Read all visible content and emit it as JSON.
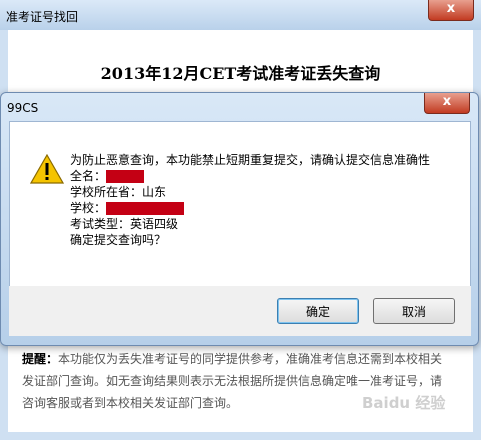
{
  "background_window": {
    "title": "准考证号找回",
    "close_label": "x",
    "heading": "2013年12月CET考试准考证丢失查询",
    "tip_label": "提醒：",
    "tip_text": "本功能仅为丢失准考证号的同学提供参考，准确准考信息还需到本校相关发证部门查询。如无查询结果则表示无法根据所提供信息确定唯一准考证号，请咨询客服或者到本校相关发证部门查询。"
  },
  "dialog": {
    "title": "99CS",
    "close_label": "x",
    "icon": "warning-icon",
    "message": {
      "line1": "为防止恶意查询，本功能禁止短期重复提交，请确认提交信息准确性",
      "name_label": "全名：",
      "province_label": "学校所在省：",
      "province_value": "山东",
      "school_label": "学校：",
      "exam_type_label": "考试类型：",
      "exam_type_value": "英语四级",
      "confirm": "确定提交查询吗？"
    },
    "ok_label": "确定",
    "cancel_label": "取消"
  },
  "colors": {
    "redaction": "#c40014",
    "title_bar": "#b9d1ea",
    "close_button": "#c23b22"
  },
  "watermark": "Baidu 经验"
}
